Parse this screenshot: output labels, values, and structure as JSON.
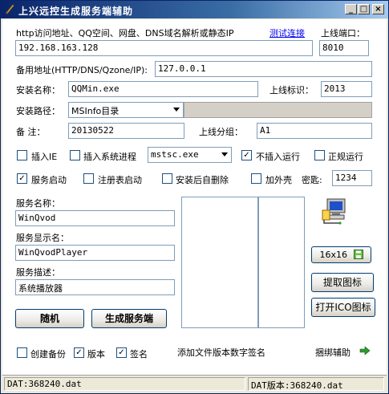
{
  "window": {
    "title": "上兴远控生成服务端辅助",
    "minimize_glyph": "_",
    "maximize_glyph": "□",
    "close_glyph": "×"
  },
  "top": {
    "url_label": "http访问地址、QQ空间、网盘、DNS域名解析或静态IP",
    "test_link": "测试连接",
    "port_label": "上线端口：",
    "address_value": "192.168.163.128",
    "port_value": "8010",
    "backup_label": "备用地址(HTTP/DNS/Qzone/IP):",
    "backup_value": "127.0.0.1"
  },
  "install": {
    "name_label": "安装名称：",
    "name_value": "QQMin.exe",
    "flag_label": "上线标识：",
    "flag_value": "2013",
    "path_label": "安装路径：",
    "path_value": "MSInfo目录",
    "note_label": "备  注：",
    "note_value": "20130522",
    "group_label": "上线分组：",
    "group_value": "A1"
  },
  "options": {
    "insert_ie": "插入IE",
    "insert_process": "插入系统进程",
    "process_value": "mstsc.exe",
    "no_insert": "不插入运行",
    "normal_run": "正规运行",
    "service_start": "服务启动",
    "registry_start": "注册表启动",
    "self_delete": "安装后自删除",
    "add_shell": "加外壳",
    "password_label": "密匙:",
    "password_value": "1234"
  },
  "service": {
    "name_label": "服务名称：",
    "name_value": "WinQvod",
    "display_label": "服务显示名：",
    "display_value": "WinQvodPlayer",
    "desc_label": "服务描述：",
    "desc_value": "系统播放器"
  },
  "icon_panel": {
    "size_label": "16x16",
    "extract_button": "提取图标",
    "open_ico_button": "打开ICO图标"
  },
  "buttons": {
    "random": "随机",
    "generate": "生成服务端"
  },
  "bottom": {
    "create_backup": "创建备份",
    "version": "版本",
    "signature": "签名",
    "add_version_sig": "添加文件版本数字签名",
    "bundle_helper": "捆绑辅助"
  },
  "status": {
    "left": "DAT:368240.dat",
    "right": "DAT版本:368240.dat"
  },
  "state": {
    "insert_ie": false,
    "insert_process": false,
    "no_insert": true,
    "normal_run": false,
    "service_start": true,
    "registry_start": false,
    "self_delete": false,
    "add_shell": false,
    "create_backup": false,
    "version": true,
    "signature": true
  },
  "colors": {
    "title_start": "#0A246A",
    "title_end": "#A6CAF0",
    "link": "#0000EE",
    "arrow_green": "#2E9A2E"
  },
  "icons": [
    "app-icon",
    "computer-network-icon",
    "save-icon",
    "arrow-right-icon"
  ]
}
